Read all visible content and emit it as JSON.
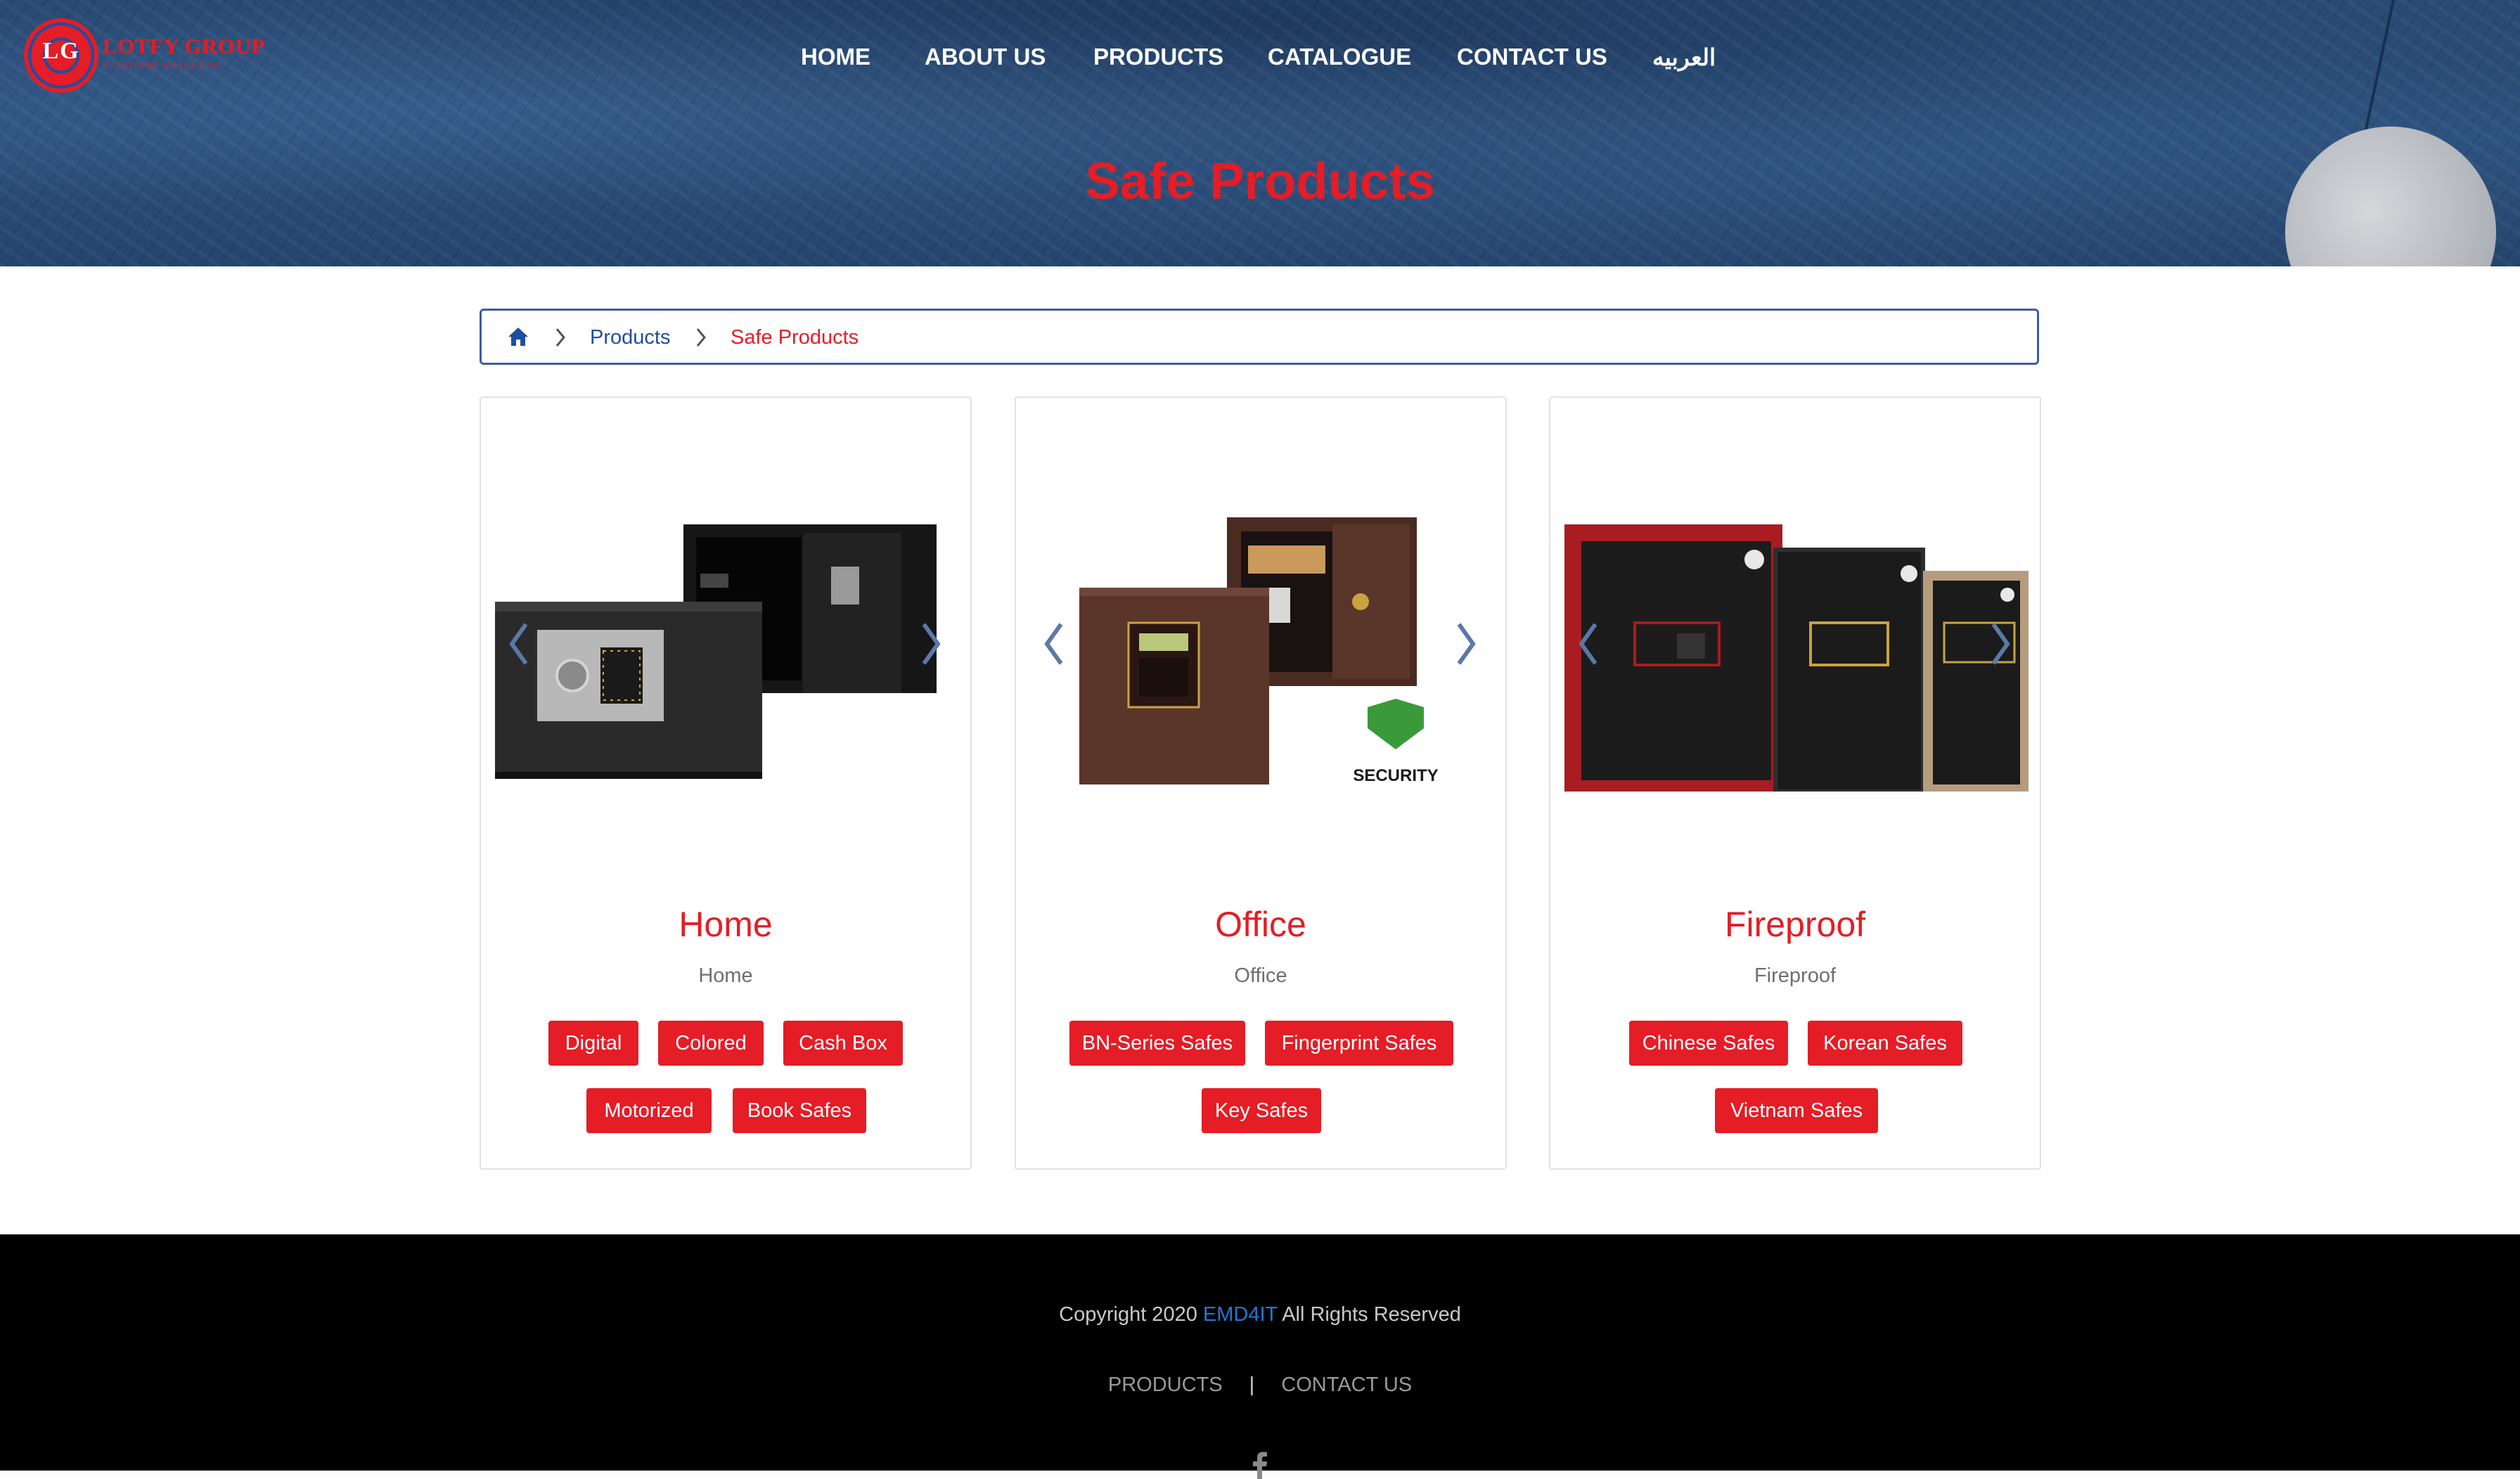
{
  "logo": {
    "initials": "LG",
    "name": "LOTFY GROUP",
    "tagline": "FURNITURE & LIGHTING"
  },
  "nav": {
    "items": [
      "HOME",
      "ABOUT US",
      "PRODUCTS",
      "CATALOGUE",
      "CONTACT US",
      "العربيه"
    ]
  },
  "hero": {
    "title": "Safe Products"
  },
  "breadcrumb": {
    "home_icon": "home-icon",
    "separator_icon": "chevron-right-icon",
    "items": [
      "Products",
      "Safe Products"
    ]
  },
  "cards": [
    {
      "title": "Home",
      "subtitle": "Home",
      "tags": [
        "Digital",
        "Colored",
        "Cash Box",
        "Motorized",
        "Book Safes"
      ]
    },
    {
      "title": "Office",
      "subtitle": "Office",
      "image_badge": "SECURITY",
      "tags": [
        "BN-Series Safes",
        "Fingerprint Safes",
        "Key Safes"
      ]
    },
    {
      "title": "Fireproof",
      "subtitle": "Fireproof",
      "tags": [
        "Chinese Safes",
        "Korean Safes",
        "Vietnam Safes"
      ]
    }
  ],
  "footer": {
    "copyright_prefix": "Copyright 2020",
    "brand": "EMD4IT",
    "copyright_suffix": "All Rights Reserved",
    "links": [
      "PRODUCTS",
      "CONTACT US"
    ],
    "separator": "|",
    "social_icon": "facebook-icon"
  },
  "colors": {
    "accent_red": "#e41d26",
    "nav_blue": "#2b4f7b",
    "breadcrumb_border": "#3d5ca8",
    "footer_bg": "#000000",
    "brand_link": "#1e78d8"
  }
}
